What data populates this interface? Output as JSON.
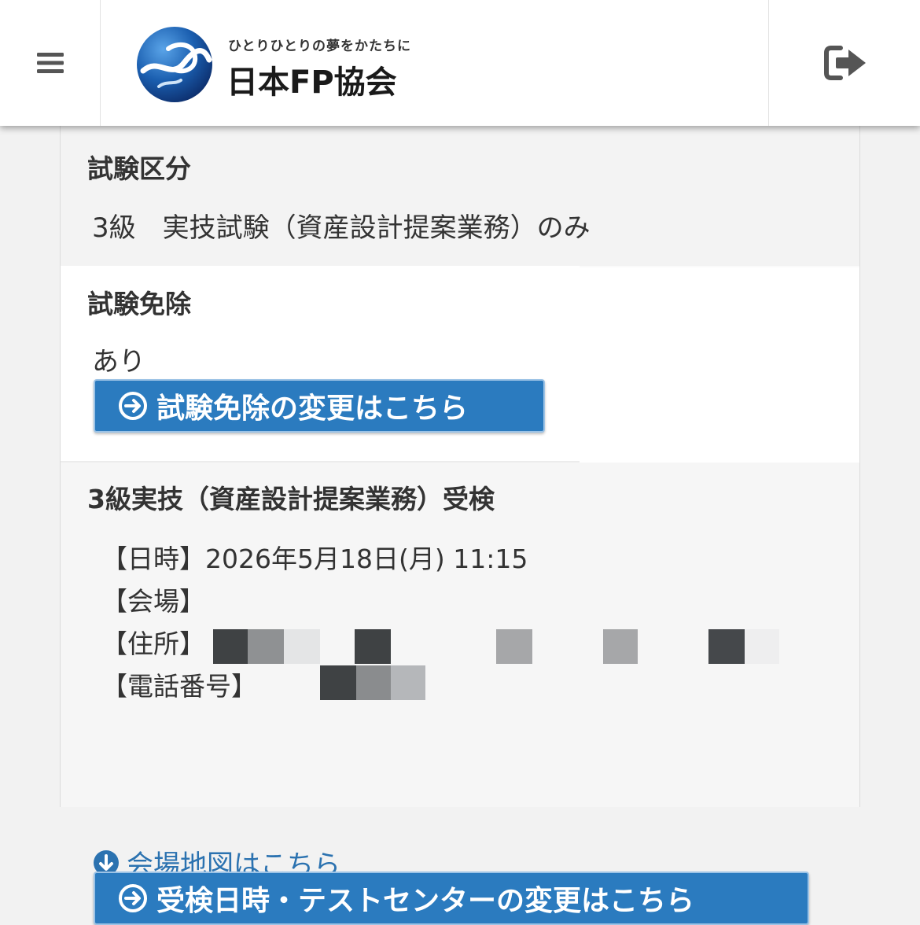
{
  "header": {
    "tagline": "ひとりひとりの夢をかたちに",
    "brand_name": "日本FP協会",
    "menu_icon": "hamburger-menu-icon",
    "logout_icon": "logout-icon",
    "colors": {
      "logo_blue": "#1b5fb0",
      "logo_dark": "#0d2f6e"
    }
  },
  "exam_category": {
    "title": "試験区分",
    "value": "3級　実技試験（資産設計提案業務）のみ"
  },
  "exemption": {
    "title": "試験免除",
    "value": "あり",
    "change_button": "試験免除の変更はこちら"
  },
  "exam_session": {
    "title": "3級実技（資産設計提案業務）受検",
    "datetime_label": "【日時】",
    "datetime_value": "2026年5月18日(月) 11:15",
    "venue_label": "【会場】",
    "address_label": "【住所】",
    "phone_label": "【電話番号】",
    "map_link": "会場地図はこちら",
    "change_button": "受検日時・テストセンターの変更はこちら"
  },
  "colors": {
    "button": "#2b7bbf",
    "link": "#2b72b0"
  }
}
